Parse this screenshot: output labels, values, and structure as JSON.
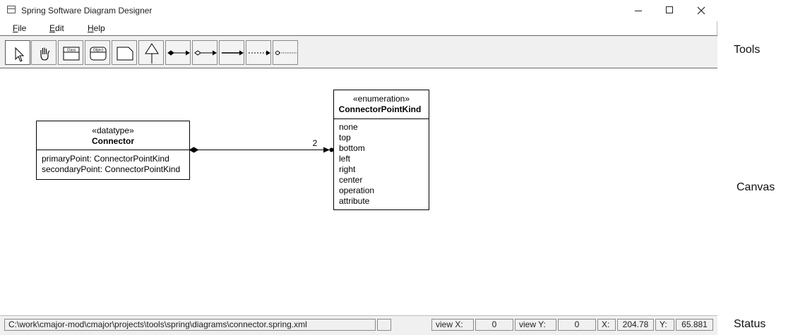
{
  "window": {
    "title": "Spring Software Diagram Designer"
  },
  "menu": [
    "File",
    "Edit",
    "Help"
  ],
  "tools": [
    {
      "name": "select-tool",
      "selected": true
    },
    {
      "name": "grab-tool"
    },
    {
      "name": "class-tool",
      "label": "Class"
    },
    {
      "name": "object-tool",
      "label": "Object"
    },
    {
      "name": "note-tool"
    },
    {
      "name": "inheritance-tool"
    },
    {
      "name": "composition-tool"
    },
    {
      "name": "aggregation-tool"
    },
    {
      "name": "reference-tool"
    },
    {
      "name": "create-instance-tool"
    },
    {
      "name": "attach-note-tool"
    }
  ],
  "diagram": {
    "connector_class": {
      "stereotype": "«datatype»",
      "name": "Connector",
      "attributes": [
        "primaryPoint: ConnectorPointKind",
        "secondaryPoint: ConnectorPointKind"
      ]
    },
    "enum_class": {
      "stereotype": "«enumeration»",
      "name": "ConnectorPointKind",
      "literals": [
        "none",
        "top",
        "bottom",
        "left",
        "right",
        "center",
        "operation",
        "attribute"
      ]
    },
    "relationship": {
      "multiplicity": "2"
    }
  },
  "status": {
    "file_path": "C:\\work\\cmajor-mod\\cmajor\\projects\\tools\\spring\\diagrams\\connector.spring.xml",
    "view_x_label": "view X:",
    "view_x": "0",
    "view_y_label": "view Y:",
    "view_y": "0",
    "x_label": "X:",
    "x": "204.78",
    "y_label": "Y:",
    "y": "65.881"
  },
  "side_labels": {
    "tools": "Tools",
    "canvas": "Canvas",
    "status": "Status"
  }
}
